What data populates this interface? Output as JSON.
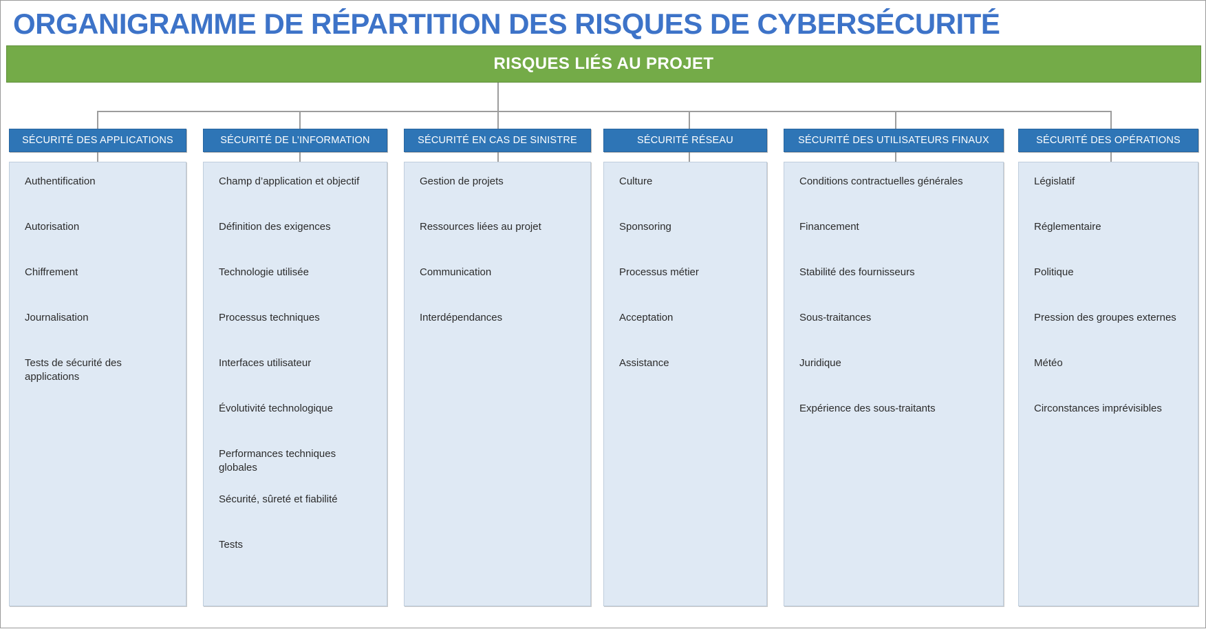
{
  "title": "ORGANIGRAMME DE RÉPARTITION DES RISQUES DE CYBERSÉCURITÉ",
  "root": {
    "label": "RISQUES LIÉS AU PROJET"
  },
  "colors": {
    "title_text": "#3d73c8",
    "root_fill": "#74ab48",
    "header_fill": "#2e75b6",
    "body_fill": "#dfe9f4",
    "connector": "#9c9c9c",
    "item_text": "#2b2b2b"
  },
  "columns": [
    {
      "header": "SÉCURITÉ DES APPLICATIONS",
      "items": [
        "Authentification",
        "Autorisation",
        "Chiffrement",
        "Journalisation",
        "Tests de sécurité des applications"
      ]
    },
    {
      "header": "SÉCURITÉ DE L’INFORMATION",
      "items": [
        "Champ d’application et objectif",
        "Définition des exigences",
        "Technologie utilisée",
        "Processus techniques",
        "Interfaces utilisateur",
        "Évolutivité technologique",
        "Performances techniques globales",
        "Sécurité, sûreté et fiabilité",
        "Tests"
      ]
    },
    {
      "header": "SÉCURITÉ EN CAS DE SINISTRE",
      "items": [
        "Gestion de projets",
        "Ressources liées au projet",
        "Communication",
        "Interdépendances"
      ]
    },
    {
      "header": "SÉCURITÉ RÉSEAU",
      "items": [
        "Culture",
        "Sponsoring",
        "Processus métier",
        "Acceptation",
        "Assistance"
      ]
    },
    {
      "header": "SÉCURITÉ DES UTILISATEURS FINAUX",
      "items": [
        "Conditions contractuelles générales",
        "Financement",
        "Stabilité des fournisseurs",
        "Sous-traitances",
        "Juridique",
        "Expérience des sous-traitants"
      ]
    },
    {
      "header": "SÉCURITÉ DES OPÉRATIONS",
      "items": [
        "Législatif",
        "Réglementaire",
        "Politique",
        "Pression des groupes externes",
        "Météo",
        "Circonstances imprévisibles"
      ]
    }
  ]
}
